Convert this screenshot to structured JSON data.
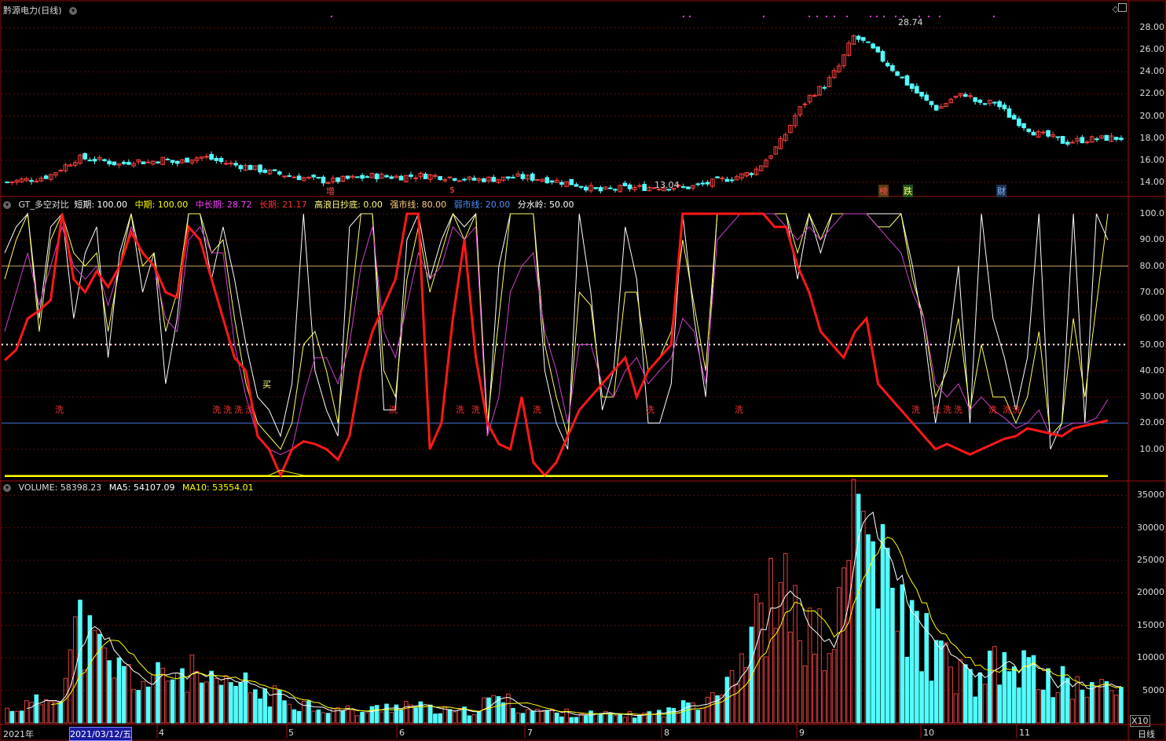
{
  "panel_price": {
    "title": "黔源电力(日线)",
    "high_label": "28.74",
    "low_label": "13.04",
    "event_badges": [
      "增",
      "$",
      "榜",
      "跌",
      "财"
    ],
    "y_ticks": [
      "28.00",
      "26.00",
      "24.00",
      "22.00",
      "20.00",
      "18.00",
      "16.00",
      "14.00"
    ],
    "colors": {
      "up": "#ff4040",
      "down": "#54fcfc"
    }
  },
  "panel_indicator": {
    "name": "GT_多空对比",
    "readouts": [
      {
        "label": "短期: 100.00",
        "color": "#ffffff"
      },
      {
        "label": "中期: 100.00",
        "color": "#ffff00"
      },
      {
        "label": "中长期: 28.72",
        "color": "#ff40ff"
      },
      {
        "label": "长期: 21.17",
        "color": "#ff3030"
      },
      {
        "label": "高浪日抄底: 0.00",
        "color": "#ffff80"
      },
      {
        "label": "强市线: 80.00",
        "color": "#ffd080"
      },
      {
        "label": "弱市线: 20.00",
        "color": "#5090ff"
      },
      {
        "label": "分水岭: 50.00",
        "color": "#ffffff"
      }
    ],
    "y_ticks": [
      "100.0",
      "90.00",
      "80.00",
      "70.00",
      "60.00",
      "50.00",
      "40.00",
      "30.00",
      "20.00",
      "10.00"
    ],
    "signal_text": "买",
    "wash_text": "洗"
  },
  "panel_volume": {
    "name": "VOLUME",
    "readouts": [
      {
        "label": "VOLUME: 58398.23",
        "color": "#dddddd"
      },
      {
        "label": "MA5: 54107.09",
        "color": "#ffffff"
      },
      {
        "label": "MA10: 53554.01",
        "color": "#ffff00"
      }
    ],
    "y_ticks": [
      "35000",
      "30000",
      "25000",
      "20000",
      "15000",
      "10000",
      "5000"
    ],
    "unit": "X10"
  },
  "x_axis": {
    "labels": [
      "2021年",
      "2021/03/12/五",
      "4",
      "5",
      "6",
      "7",
      "8",
      "9",
      "10",
      "11"
    ],
    "period": "日线"
  },
  "chart_data": [
    {
      "type": "candlestick",
      "title": "黔源电力(日线)",
      "ylim": [
        13,
        29.5
      ],
      "high": 28.74,
      "low": 13.04,
      "close_path": [
        14.0,
        14.2,
        14.3,
        14.6,
        15.4,
        16.2,
        16.1,
        15.9,
        15.6,
        16.0,
        15.8,
        16.1,
        15.7,
        16.2,
        16.3,
        15.9,
        15.6,
        15.4,
        15.1,
        14.8,
        14.6,
        14.4,
        14.2,
        14.1,
        14.3,
        14.4,
        14.6,
        14.5,
        14.5,
        14.6,
        14.6,
        14.5,
        14.4,
        14.2,
        14.3,
        14.3,
        14.5,
        14.4,
        14.3,
        14.1,
        13.9,
        13.6,
        13.2,
        13.4,
        13.5,
        13.5,
        13.6,
        13.6,
        13.5,
        13.7,
        14.0,
        14.3,
        14.6,
        15.0,
        16.3,
        17.9,
        20.3,
        21.9,
        22.8,
        24.5,
        27.2,
        26.5,
        25.2,
        24.0,
        22.7,
        21.5,
        20.6,
        21.6,
        22.0,
        21.0,
        21.3,
        20.1,
        19.2,
        18.4,
        18.1,
        17.6,
        17.8,
        17.9,
        18.0,
        18.0
      ]
    },
    {
      "type": "line",
      "ylim": [
        0,
        100
      ],
      "series": [
        {
          "name": "短期",
          "values": [
            85,
            95,
            100,
            60,
            95,
            100,
            60,
            85,
            95,
            45,
            85,
            100,
            70,
            85,
            35,
            60,
            100,
            100,
            75,
            95,
            75,
            50,
            30,
            25,
            15,
            35,
            100,
            40,
            25,
            15,
            95,
            100,
            100,
            25,
            25,
            90,
            100,
            75,
            90,
            100,
            95,
            100,
            15,
            80,
            100,
            100,
            100,
            40,
            20,
            10,
            100,
            70,
            25,
            40,
            95,
            75,
            20,
            20,
            35,
            100,
            60,
            30,
            100,
            100,
            100,
            100,
            100,
            100,
            100,
            75,
            100,
            85,
            100,
            100,
            100,
            100,
            100,
            100,
            100,
            80,
            55,
            20,
            45,
            80,
            20,
            100,
            60,
            45,
            25,
            45,
            100,
            10,
            20,
            100,
            20,
            100,
            90
          ]
        },
        {
          "name": "中期",
          "values": [
            75,
            90,
            100,
            55,
            90,
            100,
            85,
            80,
            85,
            55,
            80,
            100,
            80,
            85,
            55,
            70,
            100,
            100,
            85,
            90,
            60,
            35,
            20,
            15,
            10,
            20,
            50,
            55,
            40,
            20,
            60,
            100,
            100,
            40,
            30,
            75,
            95,
            70,
            85,
            100,
            90,
            100,
            20,
            60,
            100,
            100,
            100,
            50,
            30,
            15,
            70,
            65,
            30,
            30,
            70,
            70,
            40,
            45,
            55,
            90,
            65,
            40,
            100,
            100,
            100,
            100,
            100,
            100,
            100,
            85,
            100,
            90,
            100,
            100,
            100,
            100,
            95,
            95,
            100,
            75,
            60,
            30,
            40,
            60,
            25,
            50,
            30,
            30,
            20,
            30,
            55,
            15,
            20,
            60,
            30,
            65,
            100
          ]
        },
        {
          "name": "中长期",
          "values": [
            55,
            70,
            85,
            65,
            80,
            95,
            80,
            75,
            80,
            65,
            80,
            95,
            85,
            80,
            60,
            55,
            90,
            95,
            85,
            85,
            50,
            30,
            15,
            10,
            8,
            10,
            30,
            45,
            45,
            35,
            50,
            80,
            95,
            55,
            45,
            65,
            85,
            75,
            80,
            95,
            90,
            95,
            15,
            30,
            70,
            80,
            85,
            55,
            40,
            20,
            50,
            50,
            35,
            30,
            40,
            45,
            35,
            40,
            45,
            60,
            55,
            35,
            90,
            95,
            100,
            100,
            100,
            100,
            95,
            90,
            95,
            90,
            95,
            100,
            100,
            100,
            95,
            90,
            85,
            70,
            60,
            35,
            30,
            35,
            25,
            30,
            25,
            22,
            18,
            20,
            25,
            15,
            18,
            20,
            20,
            22,
            29
          ]
        },
        {
          "name": "长期",
          "values": [
            44,
            48,
            60,
            63,
            67,
            100,
            75,
            70,
            78,
            72,
            80,
            93,
            85,
            80,
            70,
            68,
            95,
            90,
            75,
            60,
            45,
            40,
            15,
            10,
            0,
            10,
            13,
            12,
            10,
            6,
            15,
            40,
            55,
            65,
            75,
            100,
            100,
            10,
            20,
            60,
            90,
            45,
            20,
            12,
            10,
            30,
            5,
            0,
            5,
            15,
            25,
            30,
            35,
            40,
            45,
            30,
            40,
            45,
            50,
            100,
            100,
            100,
            100,
            100,
            100,
            100,
            100,
            95,
            95,
            80,
            70,
            55,
            50,
            45,
            55,
            60,
            35,
            30,
            25,
            20,
            15,
            10,
            12,
            10,
            8,
            10,
            12,
            14,
            15,
            18,
            17,
            16,
            15,
            18,
            19,
            20,
            21
          ]
        },
        {
          "name": "高浪日抄底",
          "values": [
            0,
            0,
            0,
            0,
            0,
            0,
            0,
            0,
            0,
            0,
            0,
            0,
            0,
            0,
            0,
            0,
            0,
            0,
            0,
            0,
            0,
            0,
            0,
            0,
            2,
            1,
            0,
            0,
            0,
            0,
            0,
            0,
            0,
            0,
            0,
            0,
            0,
            0,
            0,
            0,
            0,
            0,
            0,
            0,
            0,
            0,
            0,
            0,
            0,
            0,
            0,
            0,
            0,
            0,
            0,
            0,
            0,
            0,
            0,
            0,
            0,
            0,
            0,
            0,
            0,
            0,
            0,
            0,
            0,
            0,
            0,
            0,
            0,
            0,
            0,
            0,
            0,
            0,
            0,
            0,
            0,
            0,
            0,
            0,
            0,
            0,
            0,
            0,
            0,
            0,
            0,
            0,
            0,
            0,
            0,
            0,
            0
          ]
        }
      ],
      "reference_lines": [
        {
          "name": "强市线",
          "value": 80
        },
        {
          "name": "弱市线",
          "value": 20
        },
        {
          "name": "分水岭",
          "value": 50
        }
      ]
    },
    {
      "type": "bar",
      "ylim": [
        0,
        36000
      ],
      "ylabel": "X10",
      "volume_path": [
        2000,
        2500,
        3000,
        4000,
        6000,
        15000,
        12000,
        9000,
        8000,
        7000,
        6000,
        7000,
        8000,
        7500,
        6000,
        5000,
        6000,
        5500,
        4500,
        4000,
        3500,
        3000,
        2500,
        2000,
        2000,
        1500,
        2000,
        2500,
        3000,
        2500,
        2000,
        1800,
        1500,
        2000,
        3000,
        4000,
        2500,
        2000,
        1800,
        1500,
        1500,
        1400,
        1300,
        1200,
        1200,
        1300,
        1500,
        1800,
        2500,
        3500,
        5000,
        7000,
        10000,
        14000,
        18000,
        19000,
        16000,
        13000,
        12000,
        15000,
        34000,
        29000,
        22000,
        18000,
        15000,
        13000,
        10000,
        8000,
        7000,
        6000,
        8500,
        8000,
        9000,
        7000,
        6500,
        6000,
        5500,
        5500,
        5000,
        5000
      ],
      "ma5": 54107.09,
      "ma10": 53554.01,
      "last_volume": 58398.23
    }
  ]
}
